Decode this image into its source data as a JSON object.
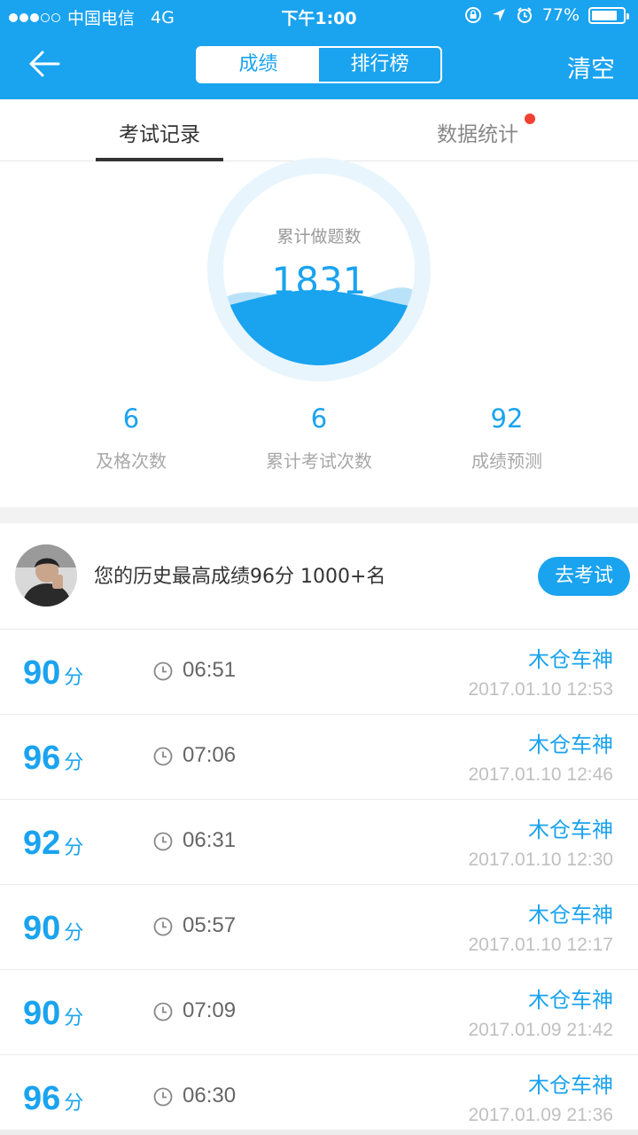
{
  "status_bar": {
    "carrier": "中国电信",
    "network": "4G",
    "time": "下午1:00",
    "battery": "77%"
  },
  "nav": {
    "back_icon": "back-arrow-icon",
    "tabs": [
      "成绩",
      "排行榜"
    ],
    "active_tab": 0,
    "clear_label": "清空"
  },
  "subtabs": {
    "exam_records": "考试记录",
    "data_stats": "数据统计"
  },
  "summary": {
    "circle_label": "累计做题数",
    "total_questions": "1831",
    "metrics": [
      {
        "value": "6",
        "label": "及格次数"
      },
      {
        "value": "6",
        "label": "累计考试次数"
      },
      {
        "value": "92",
        "label": "成绩预测"
      }
    ]
  },
  "best": {
    "text": "您的历史最高成绩96分 1000+名",
    "button": "去考试"
  },
  "records": [
    {
      "score": "90",
      "unit": "分",
      "duration": "06:51",
      "user": "木仓车神",
      "date": "2017.01.10 12:53"
    },
    {
      "score": "96",
      "unit": "分",
      "duration": "07:06",
      "user": "木仓车神",
      "date": "2017.01.10 12:46"
    },
    {
      "score": "92",
      "unit": "分",
      "duration": "06:31",
      "user": "木仓车神",
      "date": "2017.01.10 12:30"
    },
    {
      "score": "90",
      "unit": "分",
      "duration": "05:57",
      "user": "木仓车神",
      "date": "2017.01.10 12:17"
    },
    {
      "score": "90",
      "unit": "分",
      "duration": "07:09",
      "user": "木仓车神",
      "date": "2017.01.09 21:42"
    },
    {
      "score": "96",
      "unit": "分",
      "duration": "06:30",
      "user": "木仓车神",
      "date": "2017.01.09 21:36"
    }
  ],
  "colors": {
    "accent": "#1aa3ef",
    "notice_dot": "#f04133"
  }
}
